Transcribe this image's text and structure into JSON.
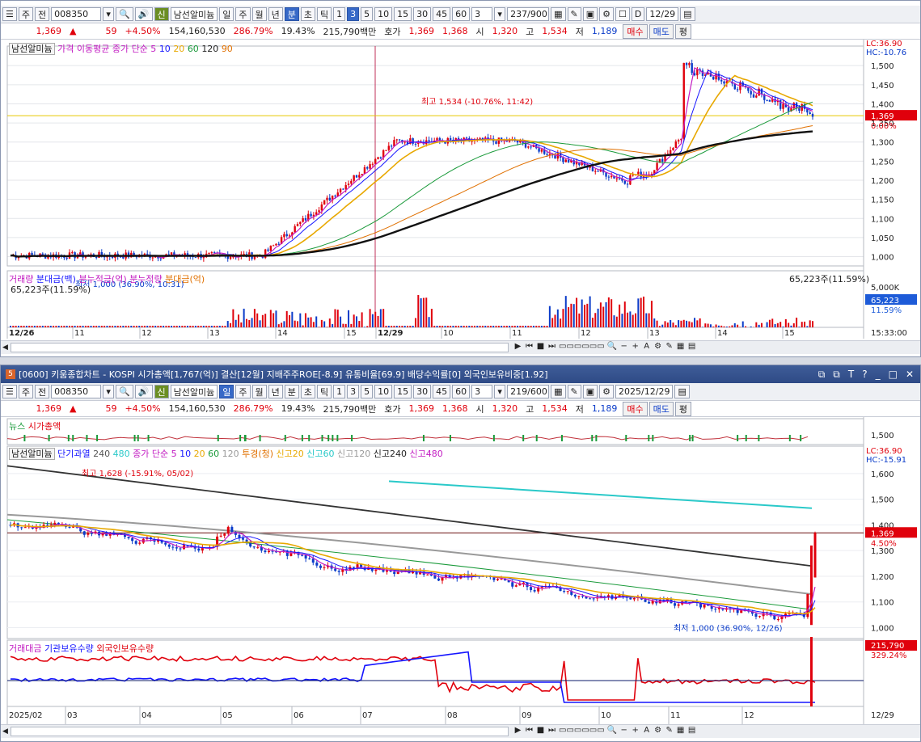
{
  "top": {
    "toolbar": {
      "menu_icon": "☰",
      "type": "주",
      "prev": "전",
      "code": "008350",
      "new_badge": "신",
      "stock_name": "남선알미늄",
      "periods": [
        "일",
        "주",
        "월",
        "년"
      ],
      "minute": "분",
      "second": "초",
      "tick": "틱",
      "intervals": [
        "1",
        "3",
        "5",
        "10",
        "15",
        "30",
        "45",
        "60"
      ],
      "interval_sel": "3",
      "count_value": "3",
      "count": "237/900",
      "date": "12/29",
      "checkbox_label": "D"
    },
    "info": {
      "price": "1,369",
      "change": "59",
      "rate": "+4.50%",
      "volume": "154,160,530",
      "vol_rate": "286.79%",
      "turnover": "19.43%",
      "amount": "215,790백만",
      "hoga_label": "호가",
      "ask": "1,369",
      "bid": "1,368",
      "open_label": "시",
      "open": "1,320",
      "high_label": "고",
      "high": "1,534",
      "low_label": "저",
      "low": "1,189",
      "buy": "매수",
      "sell": "매도",
      "flat": "평"
    },
    "legend_price": [
      "남선알미늄",
      "가격 이동평균",
      "종가 단순 5",
      "10",
      "20",
      "60",
      "120",
      "90"
    ],
    "legend_price_colors": [
      "#333333",
      "#c21bc2",
      "#c21bc2",
      "#1515ff",
      "#e8a800",
      "#1a9a3a",
      "#222222",
      "#e07000"
    ],
    "lc": "LC:36.90",
    "hc": "HC:-10.76",
    "max_label": "최고 1,534 (-10.76%, 11:42)",
    "min_label": "최저 1,000 (36.90%, 10:31)",
    "price_axis": [
      "1,500",
      "1,450",
      "1,400",
      "1,350",
      "1,300",
      "1,250",
      "1,200",
      "1,150",
      "1,100",
      "1,050",
      "1,000"
    ],
    "price_tag": "1,369",
    "price_tag_pct": "0.00%",
    "legend_vol": [
      "거래량",
      "분대금(백)",
      "분누적금(억)",
      "분누적량",
      "분대금(억)"
    ],
    "legend_vol_colors": [
      "#c21bc2",
      "#1515ff",
      "#c21bc2",
      "#c21bc2",
      "#e07000"
    ],
    "vol_text": "65,223주(11.59%)",
    "vol_right": "65,223주(11.59%)",
    "vol_axis_top": "5,000K",
    "vol_tag": "65,223",
    "vol_tag_pct": "11.59%",
    "time_axis": [
      "12/26",
      "11",
      "12",
      "13",
      "14",
      "15",
      "12/29",
      "10",
      "11",
      "12",
      "13",
      "14",
      "15"
    ],
    "time_end": "15:33:00"
  },
  "bottom": {
    "title": "[0600] 키움종합차트 - KOSPI 시가총액[1,767(억)] 결산[12월] 지배주주ROE[-8.9] 유통비율[69.9] 배당수익률[0] 외국인보유비중[1.92]",
    "window_num": "5",
    "toolbar": {
      "menu_icon": "☰",
      "type": "주",
      "prev": "전",
      "code": "008350",
      "new_badge": "신",
      "stock_name": "남선알미늄",
      "periods": [
        "일",
        "주",
        "월",
        "년"
      ],
      "minute": "분",
      "second": "초",
      "tick": "틱",
      "intervals": [
        "1",
        "3",
        "5",
        "10",
        "15",
        "30",
        "45",
        "60"
      ],
      "count_value": "3",
      "count": "219/600",
      "date": "2025/12/29"
    },
    "info": {
      "price": "1,369",
      "change": "59",
      "rate": "+4.50%",
      "volume": "154,160,530",
      "vol_rate": "286.79%",
      "turnover": "19.43%",
      "amount": "215,790백만",
      "hoga_label": "호가",
      "ask": "1,369",
      "bid": "1,368",
      "open_label": "시",
      "open": "1,320",
      "high_label": "고",
      "high": "1,534",
      "low_label": "저",
      "low": "1,189",
      "buy": "매수",
      "sell": "매도",
      "flat": "평"
    },
    "news_legend": [
      "뉴스",
      "시가총액"
    ],
    "news_axis": "1,500",
    "legend_price": [
      "남선알미늄",
      "단기과열",
      "240",
      "480",
      "종가 단순 5",
      "10",
      "20",
      "60",
      "120",
      "투경(청)",
      "신고20",
      "신고60",
      "신고120",
      "신고240",
      "신고480"
    ],
    "legend_price_colors": [
      "#333333",
      "#1515ff",
      "#555555",
      "#2ac9c9",
      "#c21bc2",
      "#1515ff",
      "#e8a800",
      "#1a9a3a",
      "#999999",
      "#e07000",
      "#e8a800",
      "#2ac9c9",
      "#999999",
      "#222222",
      "#c21bc2"
    ],
    "lc": "LC:36.90",
    "hc": "HC:-15.91",
    "max_label": "최고 1,628 (-15.91%, 05/02)",
    "min_label": "최저 1,000 (36.90%, 12/26)",
    "price_axis": [
      "1,600",
      "1,500",
      "1,400",
      "1,300",
      "1,200",
      "1,100",
      "1,000"
    ],
    "price_tag": "1,369",
    "price_tag_pct": "4.50%",
    "legend_vol": [
      "거래대금",
      "기관보유수량",
      "외국인보유수량"
    ],
    "legend_vol_colors": [
      "#c21bc2",
      "#1515ff",
      "#e0000c"
    ],
    "vol_tag": "215,790",
    "vol_tag_pct": "329.24%",
    "time_axis": [
      "2025/02",
      "03",
      "04",
      "05",
      "06",
      "07",
      "08",
      "09",
      "10",
      "11",
      "12"
    ],
    "time_end": "12/29"
  },
  "colors": {
    "up": "#e0000c",
    "down": "#0b3cc9",
    "title_bg": "#2e4a86",
    "accent": "#3769c7"
  }
}
